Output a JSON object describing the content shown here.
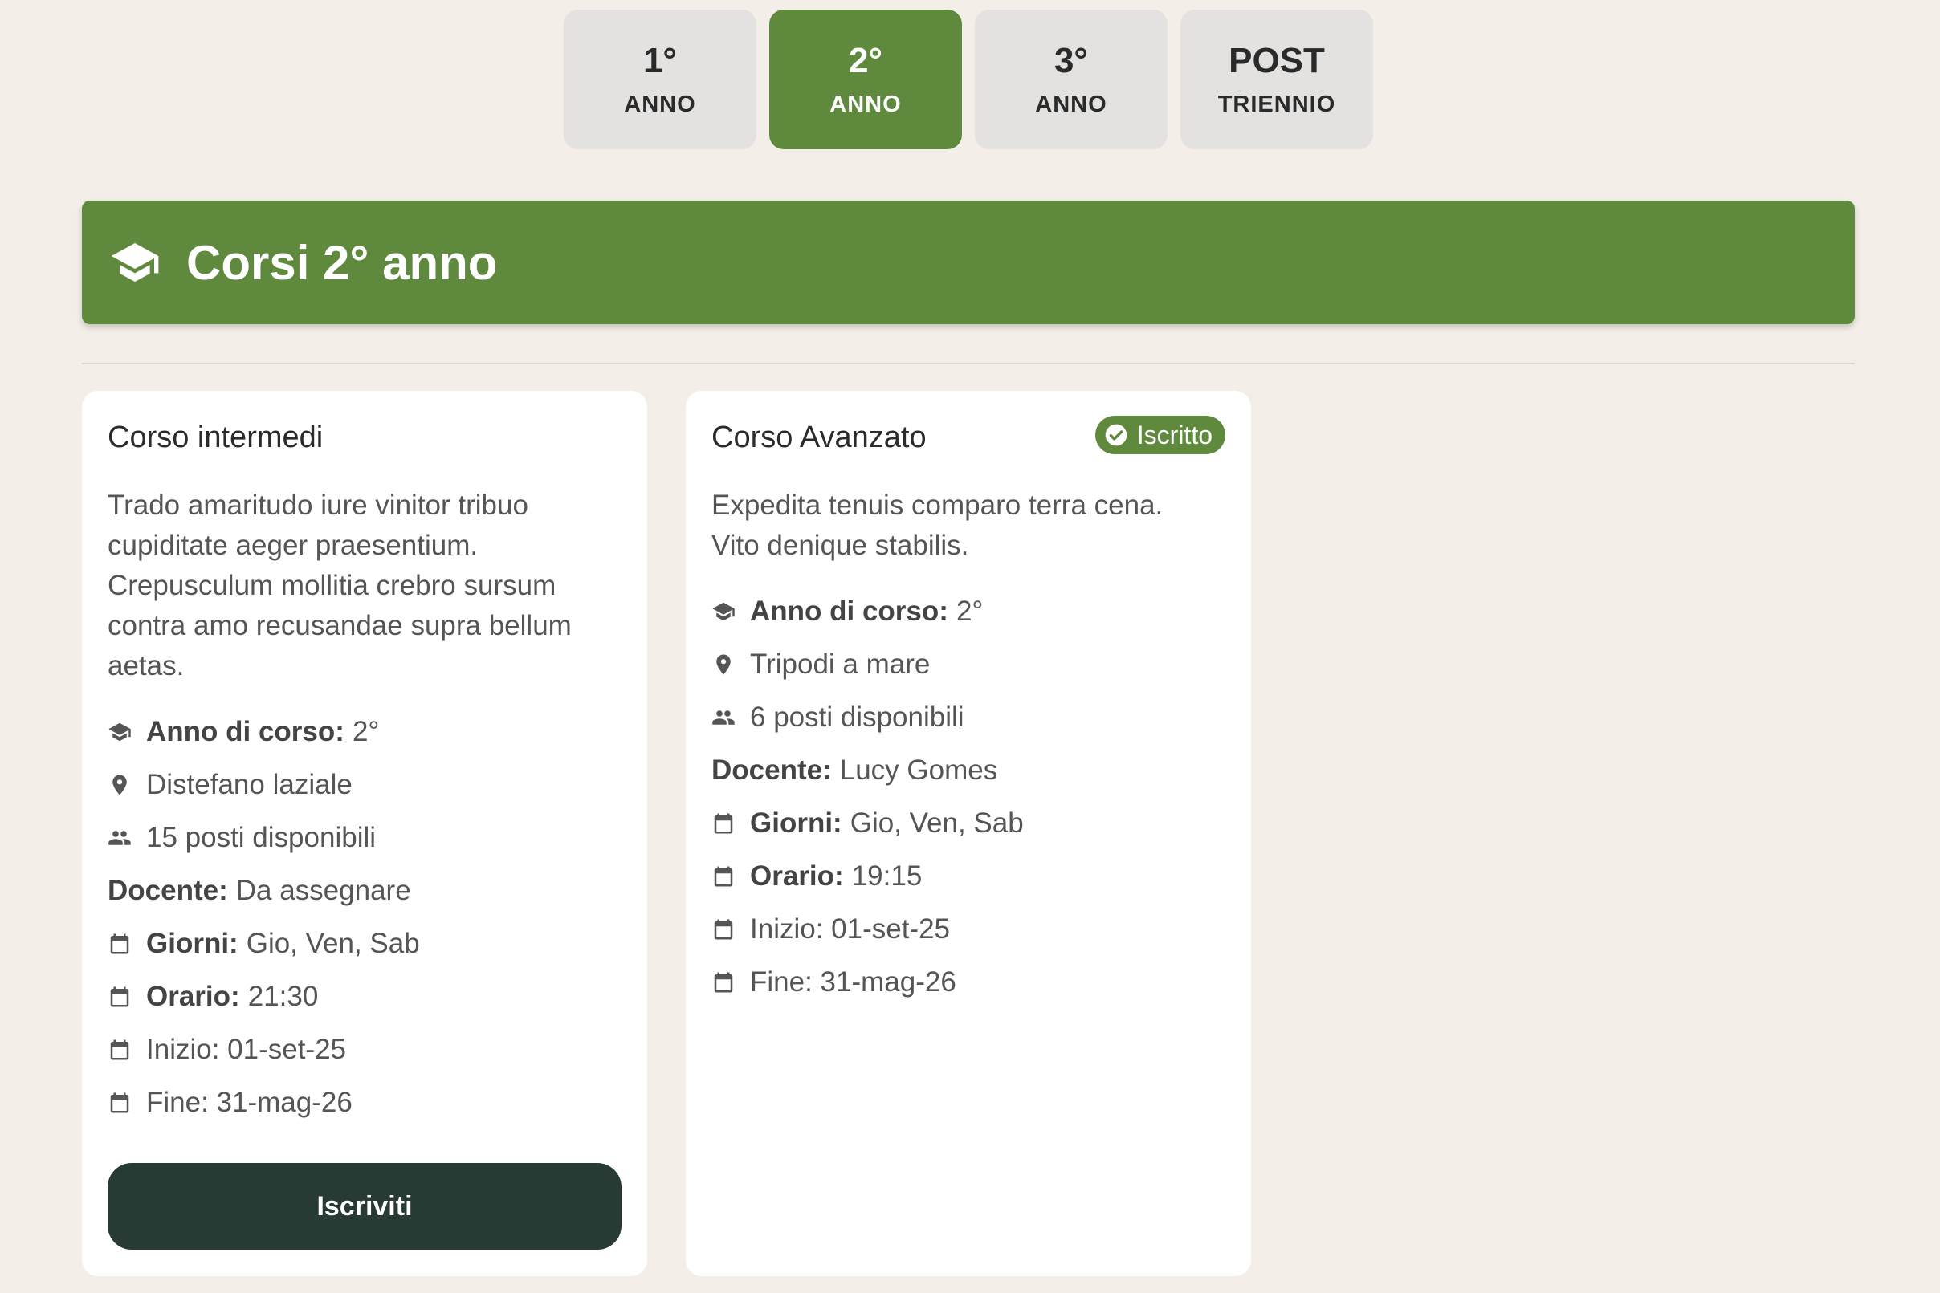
{
  "tabs": [
    {
      "num": "1°",
      "label": "ANNO",
      "active": false
    },
    {
      "num": "2°",
      "label": "ANNO",
      "active": true
    },
    {
      "num": "3°",
      "label": "ANNO",
      "active": false
    },
    {
      "num": "POST",
      "label": "TRIENNIO",
      "active": false
    }
  ],
  "section": {
    "title": "Corsi 2° anno",
    "icon": "graduation-cap-icon"
  },
  "colors": {
    "accent": "#5f8a3e",
    "button_dark": "#283a34",
    "background": "#f3eee8"
  },
  "courses": [
    {
      "title": "Corso intermedi",
      "description": "Trado amaritudo iure vinitor tribuo cupiditate aeger praesentium. Crepusculum mollitia crebro sursum contra amo recusandae supra bellum aetas.",
      "year_label": "Anno di corso:",
      "year_value": "2°",
      "location": "Distefano laziale",
      "seats": "15 posti disponibili",
      "teacher_label": "Docente:",
      "teacher_value": "Da assegnare",
      "days_label": "Giorni:",
      "days_value": "Gio, Ven, Sab",
      "time_label": "Orario:",
      "time_value": "21:30",
      "start": "Inizio: 01-set-25",
      "end": "Fine: 31-mag-26",
      "button_label": "Iscriviti"
    },
    {
      "title": "Corso Avanzato",
      "badge": "Iscritto",
      "description": "Expedita tenuis comparo terra cena. Vito denique stabilis.",
      "year_label": "Anno di corso:",
      "year_value": "2°",
      "location": "Tripodi a mare",
      "seats": "6 posti disponibili",
      "teacher_label": "Docente:",
      "teacher_value": "Lucy Gomes",
      "days_label": "Giorni:",
      "days_value": "Gio, Ven, Sab",
      "time_label": "Orario:",
      "time_value": "19:15",
      "start": "Inizio: 01-set-25",
      "end": "Fine: 31-mag-26"
    }
  ]
}
